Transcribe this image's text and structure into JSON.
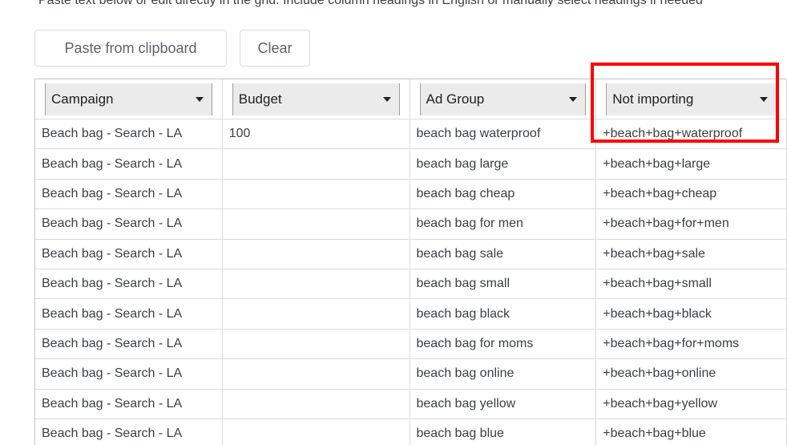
{
  "instructions": "Paste text below or edit directly in the grid. Include column headings in English or manually select headings if needed",
  "toolbar": {
    "paste_label": "Paste from clipboard",
    "clear_label": "Clear"
  },
  "columns": [
    {
      "label": "Campaign"
    },
    {
      "label": "Budget"
    },
    {
      "label": "Ad Group"
    },
    {
      "label": "Not importing"
    }
  ],
  "rows": [
    {
      "campaign": "Beach bag - Search - LA",
      "budget": "100",
      "ad_group": "beach bag waterproof",
      "keyword": "+beach+bag+waterproof"
    },
    {
      "campaign": "Beach bag - Search - LA",
      "budget": "",
      "ad_group": "beach bag large",
      "keyword": "+beach+bag+large"
    },
    {
      "campaign": "Beach bag - Search - LA",
      "budget": "",
      "ad_group": "beach bag cheap",
      "keyword": "+beach+bag+cheap"
    },
    {
      "campaign": "Beach bag - Search - LA",
      "budget": "",
      "ad_group": "beach bag for men",
      "keyword": "+beach+bag+for+men"
    },
    {
      "campaign": "Beach bag - Search - LA",
      "budget": "",
      "ad_group": "beach bag sale",
      "keyword": "+beach+bag+sale"
    },
    {
      "campaign": "Beach bag - Search - LA",
      "budget": "",
      "ad_group": "beach bag small",
      "keyword": "+beach+bag+small"
    },
    {
      "campaign": "Beach bag - Search - LA",
      "budget": "",
      "ad_group": "beach bag black",
      "keyword": "+beach+bag+black"
    },
    {
      "campaign": "Beach bag - Search - LA",
      "budget": "",
      "ad_group": "beach bag for moms",
      "keyword": "+beach+bag+for+moms"
    },
    {
      "campaign": "Beach bag - Search - LA",
      "budget": "",
      "ad_group": "beach bag online",
      "keyword": "+beach+bag+online"
    },
    {
      "campaign": "Beach bag - Search - LA",
      "budget": "",
      "ad_group": "beach bag yellow",
      "keyword": "+beach+bag+yellow"
    },
    {
      "campaign": "Beach bag - Search - LA",
      "budget": "",
      "ad_group": "beach bag blue",
      "keyword": "+beach+bag+blue"
    }
  ],
  "colors": {
    "highlight": "#ff0000",
    "header_bg": "#ebebeb",
    "border": "#dadce0"
  }
}
